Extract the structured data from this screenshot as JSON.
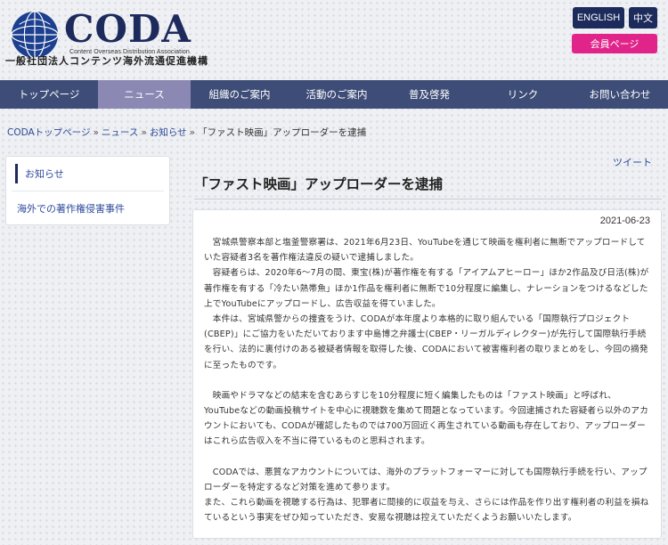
{
  "header": {
    "logo_text": "CODA",
    "logo_sub": "Content Overseas Distribution Association",
    "org_name_jp": "一般社団法人コンテンツ海外流通促進機構",
    "lang_en": "ENGLISH",
    "lang_zh": "中文",
    "member_page": "会員ページ"
  },
  "nav": {
    "items": [
      {
        "label": "トップページ"
      },
      {
        "label": "ニュース"
      },
      {
        "label": "組織のご案内"
      },
      {
        "label": "活動のご案内"
      },
      {
        "label": "普及啓発"
      },
      {
        "label": "リンク"
      },
      {
        "label": "お問い合わせ"
      }
    ]
  },
  "breadcrumb": {
    "home": "CODAトップページ",
    "news": "ニュース",
    "notice": "お知らせ",
    "current": "「ファスト映画」アップローダーを逮捕",
    "sep": "»"
  },
  "sidebar": {
    "items": [
      {
        "label": "お知らせ"
      },
      {
        "label": "海外での著作権侵害事件"
      }
    ]
  },
  "article": {
    "tweet": "ツイート",
    "title": "「ファスト映画」アップローダーを逮捕",
    "date": "2021-06-23",
    "paragraphs": [
      "　宮城県警察本部と塩釜警察署は、2021年6月23日、YouTubeを通じて映画を権利者に無断でアップロードしていた容疑者3名を著作権法違反の疑いで逮捕しました。",
      "　容疑者らは、2020年6～7月の間、東宝(株)が著作権を有する「アイアムアヒーロー」ほか2作品及び日活(株)が著作権を有する「冷たい熱帯魚」ほか1作品を権利者に無断で10分程度に編集し、ナレーションをつけるなどした上でYouTubeにアップロードし、広告収益を得ていました。",
      "　本件は、宮城県警からの捜査をうけ、CODAが本年度より本格的に取り組んでいる「国際執行プロジェクト(CBEP)」にご協力をいただいております中島博之弁護士(CBEP・リーガルディレクター)が先行して国際執行手続を行い、法的に裏付けのある被疑者情報を取得した後、CODAにおいて被害権利者の取りまとめをし、今回の摘発に至ったものです。",
      "　映画やドラマなどの結末を含むあらすじを10分程度に短く編集したものは「ファスト映画」と呼ばれ、YouTubeなどの動画投稿サイトを中心に視聴数を集めて問題となっています。今回逮捕された容疑者ら以外のアカウントにおいても、CODAが確認したものでは700万回近く再生されている動画も存在しており、アップローダーはこれら広告収入を不当に得ているものと思料されます。",
      "　CODAでは、悪質なアカウントについては、海外のプラットフォーマーに対しても国際執行手続を行い、アップローダーを特定するなど対策を進めて参ります。",
      "また、これら動画を視聴する行為は、犯罪者に間接的に収益を与え、さらには作品を作り出す権利者の利益を損ねているという事実をぜひ知っていただき、安易な視聴は控えていただくようお願いいたします。"
    ]
  },
  "colors": {
    "brand_navy": "#1d2a5c",
    "nav_bg": "#3e4d78",
    "nav_active": "#8b88b3",
    "member_pink": "#e0248a",
    "link_blue": "#2d4a9a"
  }
}
